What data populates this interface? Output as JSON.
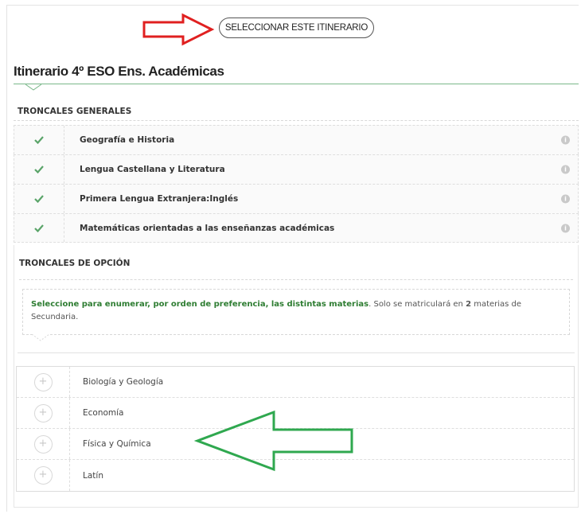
{
  "header": {
    "select_button_label": "SELECCIONAR ESTE ITINERARIO",
    "title": "Itinerario 4º ESO Ens. Académicas"
  },
  "troncales_generales": {
    "heading": "TRONCALES GENERALES",
    "rows": [
      {
        "label": "Geografía e Historia",
        "checked": true
      },
      {
        "label": "Lengua Castellana y Literatura",
        "checked": true
      },
      {
        "label": "Primera Lengua Extranjera:Inglés",
        "checked": true
      },
      {
        "label": "Matemáticas orientadas a las enseñanzas académicas",
        "checked": true
      }
    ]
  },
  "troncales_opcion": {
    "heading": "TRONCALES DE OPCIÓN",
    "notice_bold": "Seleccione para enumerar, por orden de preferencia, las distintas materias",
    "notice_text_1": ". Solo se matriculará en ",
    "notice_count": "2",
    "notice_text_2": " materias de Secundaria.",
    "options": [
      {
        "label": "Biología y Geología"
      },
      {
        "label": "Economía"
      },
      {
        "label": "Física y Química"
      },
      {
        "label": "Latín"
      }
    ]
  },
  "icons": {
    "check": "check-icon",
    "info": "info-icon",
    "plus": "plus-circle-icon"
  },
  "colors": {
    "accent_green": "#5aa469",
    "annotation_red": "#e02020",
    "annotation_green": "#2fa84f"
  }
}
